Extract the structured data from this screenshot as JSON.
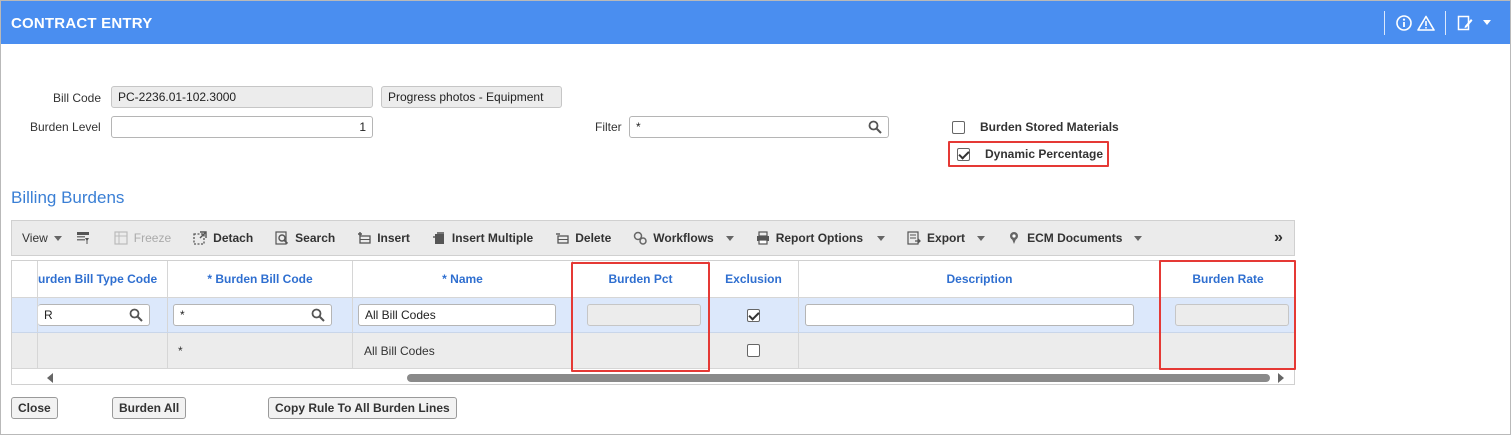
{
  "window": {
    "title": "CONTRACT ENTRY",
    "header_icons": [
      "info-icon",
      "warning-icon",
      "edit-icon",
      "chevron-down-icon"
    ]
  },
  "form": {
    "bill_code_label": "Bill Code",
    "bill_code_value": "PC-2236.01-102.3000",
    "bill_code_desc": "Progress photos - Equipment",
    "burden_level_label": "Burden Level",
    "burden_level_value": "1",
    "filter_label": "Filter",
    "filter_value": "*",
    "burden_stored_materials_label": "Burden Stored Materials",
    "burden_stored_materials_checked": false,
    "dynamic_percentage_label": "Dynamic Percentage",
    "dynamic_percentage_checked": true
  },
  "section": {
    "title": "Billing Burdens"
  },
  "toolbar": {
    "view": "View",
    "freeze": "Freeze",
    "detach": "Detach",
    "search": "Search",
    "insert": "Insert",
    "insert_multiple": "Insert Multiple",
    "delete": "Delete",
    "workflows": "Workflows",
    "report_options": "Report Options",
    "export": "Export",
    "ecm_documents": "ECM Documents",
    "more": "»"
  },
  "grid": {
    "columns": {
      "burden_bill_type_code": "urden Bill Type Code",
      "burden_bill_code": "* Burden Bill Code",
      "name": "* Name",
      "burden_pct": "Burden Pct",
      "exclusion": "Exclusion",
      "description": "Description",
      "burden_rate": "Burden Rate"
    },
    "filter_row": {
      "burden_bill_type_code": "R",
      "burden_bill_code": "*",
      "name": "All Bill Codes",
      "exclusion_checked": true
    },
    "data_row": {
      "burden_bill_code": "*",
      "name": "All Bill Codes",
      "exclusion_checked": false
    }
  },
  "buttons": {
    "close": "Close",
    "burden_all": "Burden All",
    "copy_rule": "Copy Rule To All Burden Lines"
  }
}
